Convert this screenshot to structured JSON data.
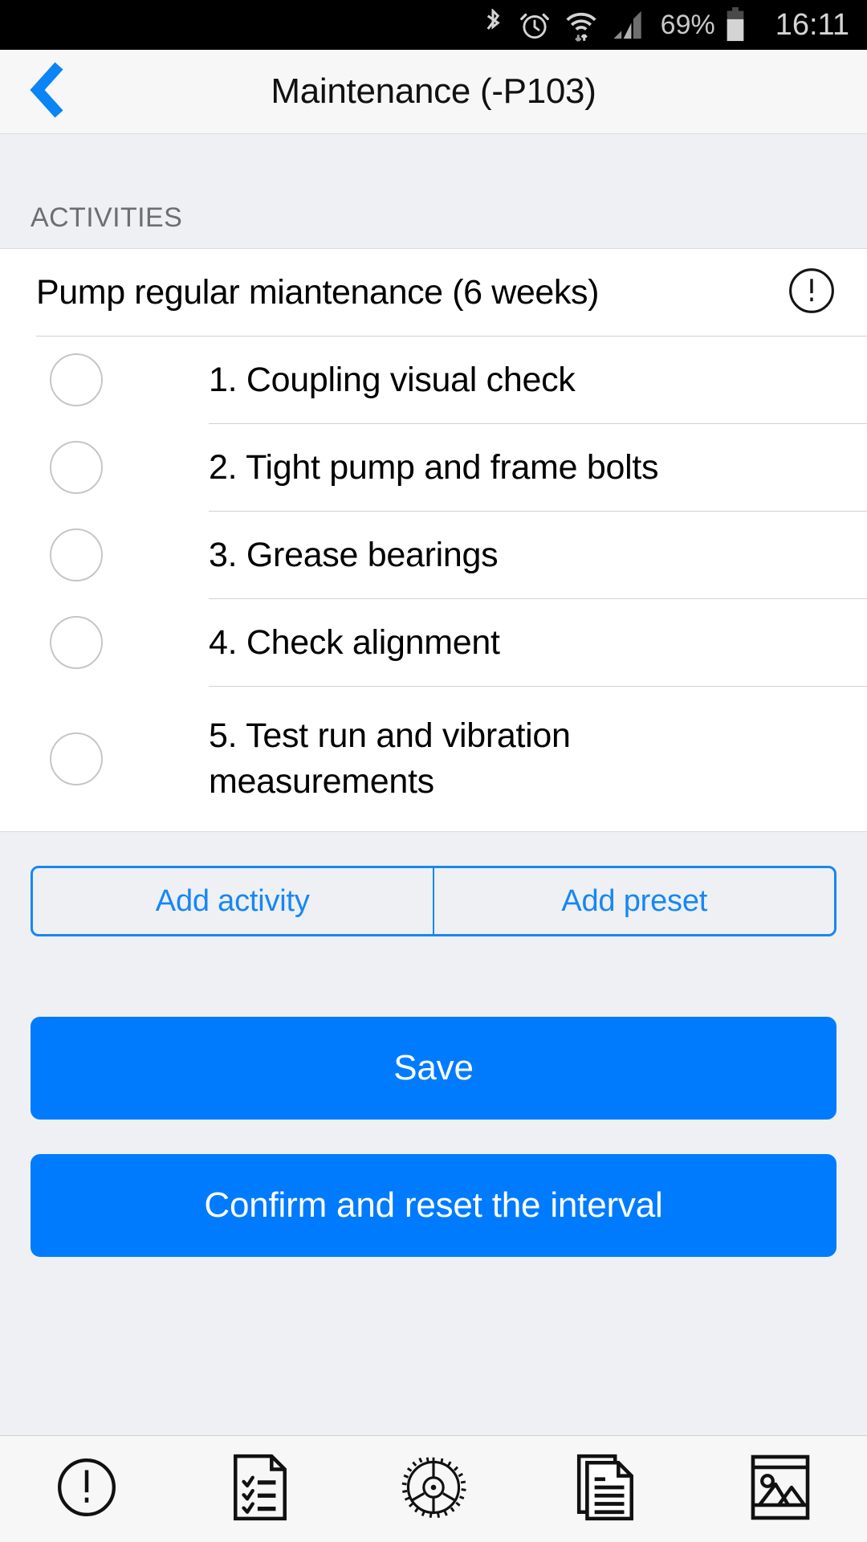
{
  "statusbar": {
    "battery_percent": "69%",
    "time": "16:11",
    "icons": [
      "bluetooth-icon",
      "alarm-icon",
      "wifi-icon",
      "signal-icon",
      "battery-icon"
    ]
  },
  "navbar": {
    "back_icon": "chevron-left-icon",
    "title": "Maintenance (-P103)"
  },
  "sections": {
    "activities_header": "ACTIVITIES"
  },
  "activity": {
    "title": "Pump regular miantenance (6 weeks)",
    "alert_icon": "alert-circle-icon",
    "tasks": [
      {
        "label": "1. Coupling visual check",
        "checked": false
      },
      {
        "label": "2. Tight pump and frame bolts",
        "checked": false
      },
      {
        "label": "3. Grease bearings",
        "checked": false
      },
      {
        "label": "4. Check alignment",
        "checked": false
      },
      {
        "label": "5. Test run and vibration measurements",
        "checked": false
      }
    ]
  },
  "footer": {
    "add_activity_label": "Add activity",
    "add_preset_label": "Add preset",
    "save_label": "Save",
    "confirm_label": "Confirm and reset the interval"
  },
  "tabbar": {
    "items": [
      {
        "name": "alert-circle-icon"
      },
      {
        "name": "checklist-document-icon"
      },
      {
        "name": "gear-icon"
      },
      {
        "name": "documents-icon"
      },
      {
        "name": "image-icon"
      }
    ]
  },
  "colors": {
    "accent_blue": "#017bfe",
    "outline_blue": "#1787f5",
    "page_bg": "#eff0f3",
    "card_bg": "#ffffff",
    "nav_bg": "#f7f7f7"
  }
}
